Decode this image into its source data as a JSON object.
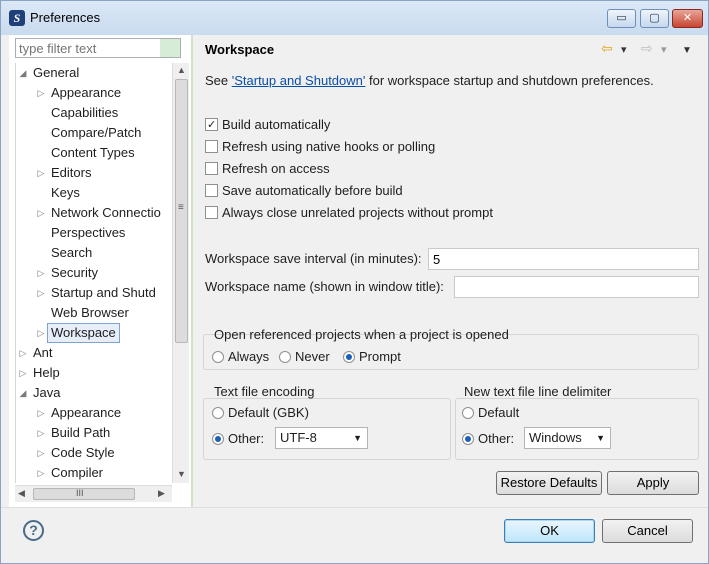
{
  "window": {
    "title": "Preferences",
    "minimize": "▭",
    "maximize": "▢",
    "close": "✕"
  },
  "sidebar": {
    "filter_placeholder": "type filter text",
    "tree": [
      {
        "label": "General",
        "level": 0,
        "twist": "◢"
      },
      {
        "label": "Appearance",
        "level": 1,
        "twist": "▷"
      },
      {
        "label": "Capabilities",
        "level": 1,
        "twist": ""
      },
      {
        "label": "Compare/Patch",
        "level": 1,
        "twist": ""
      },
      {
        "label": "Content Types",
        "level": 1,
        "twist": ""
      },
      {
        "label": "Editors",
        "level": 1,
        "twist": "▷"
      },
      {
        "label": "Keys",
        "level": 1,
        "twist": ""
      },
      {
        "label": "Network Connectio",
        "level": 1,
        "twist": "▷"
      },
      {
        "label": "Perspectives",
        "level": 1,
        "twist": ""
      },
      {
        "label": "Search",
        "level": 1,
        "twist": ""
      },
      {
        "label": "Security",
        "level": 1,
        "twist": "▷"
      },
      {
        "label": "Startup and Shutd",
        "level": 1,
        "twist": "▷"
      },
      {
        "label": "Web Browser",
        "level": 1,
        "twist": ""
      },
      {
        "label": "Workspace",
        "level": 1,
        "twist": "▷",
        "selected": true
      },
      {
        "label": "Ant",
        "level": 0,
        "twist": "▷"
      },
      {
        "label": "Help",
        "level": 0,
        "twist": "▷"
      },
      {
        "label": "Java",
        "level": 0,
        "twist": "◢"
      },
      {
        "label": "Appearance",
        "level": 1,
        "twist": "▷"
      },
      {
        "label": "Build Path",
        "level": 1,
        "twist": "▷"
      },
      {
        "label": "Code Style",
        "level": 1,
        "twist": "▷"
      },
      {
        "label": "Compiler",
        "level": 1,
        "twist": "▷"
      }
    ],
    "vscroll_up": "▲",
    "vscroll_down": "▼",
    "vscroll_grip": "≡",
    "hscroll_left": "◀",
    "hscroll_right": "▶",
    "hscroll_grip": "III"
  },
  "page": {
    "title": "Workspace",
    "nav_back_icon": "⇦",
    "nav_forward_icon": "⇨",
    "nav_dropdown": "▾",
    "menu_icon": "▼",
    "desc_prefix": "See ",
    "desc_link": "'Startup and Shutdown'",
    "desc_suffix": " for workspace startup and shutdown preferences.",
    "checkboxes": [
      {
        "label": "Build automatically",
        "checked": true
      },
      {
        "label": "Refresh using native hooks or polling",
        "checked": false
      },
      {
        "label": "Refresh on access",
        "checked": false
      },
      {
        "label": "Save automatically before build",
        "checked": false
      },
      {
        "label": "Always close unrelated projects without prompt",
        "checked": false
      }
    ],
    "save_interval_label": "Workspace save interval (in minutes):",
    "save_interval_value": "5",
    "workspace_name_label": "Workspace name (shown in window title):",
    "workspace_name_value": "",
    "open_projects": {
      "title": "Open referenced projects when a project is opened",
      "options": [
        "Always",
        "Never",
        "Prompt"
      ],
      "selected": "Prompt"
    },
    "encoding": {
      "title": "Text file encoding",
      "default_label": "Default (GBK)",
      "other_label": "Other:",
      "other_value": "UTF-8",
      "selected": "Other"
    },
    "delimiter": {
      "title": "New text file line delimiter",
      "default_label": "Default",
      "other_label": "Other:",
      "other_value": "Windows",
      "selected": "Other"
    },
    "restore_defaults": "Restore Defaults",
    "apply": "Apply"
  },
  "footer": {
    "help_icon": "?",
    "ok": "OK",
    "cancel": "Cancel"
  }
}
